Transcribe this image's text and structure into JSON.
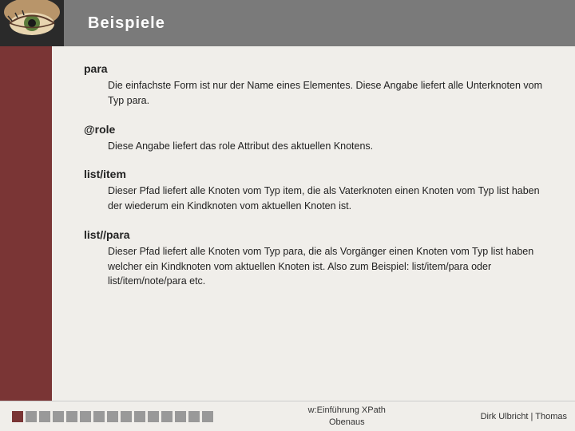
{
  "header": {
    "title": "Beispiele"
  },
  "sections": [
    {
      "id": "para",
      "title": "para",
      "body": "Die einfachste Form ist nur der Name eines Elementes. Diese Angabe liefert alle Unterknoten vom Typ para."
    },
    {
      "id": "role",
      "title": "@role",
      "body": "Diese Angabe liefert das role Attribut des aktuellen Knotens."
    },
    {
      "id": "list-item",
      "title": "list/item",
      "body": "Dieser Pfad liefert alle Knoten vom Typ item, die als Vaterknoten einen Knoten vom Typ list haben der wiederum ein Kindknoten vom aktuellen Knoten ist."
    },
    {
      "id": "list-para",
      "title": "list//para",
      "body": "Dieser Pfad liefert alle Knoten vom Typ para, die als Vorgänger einen Knoten vom Typ list haben welcher ein Kindknoten vom aktuellen Knoten ist. Also zum Beispiel: list/item/para oder list/item/note/para etc."
    }
  ],
  "footer": {
    "center_line1": "w:Einführung XPath",
    "center_line2": "Obenaus",
    "right": "Dirk Ulbricht | Thomas"
  },
  "squares": {
    "dark": 1,
    "light": 14
  }
}
